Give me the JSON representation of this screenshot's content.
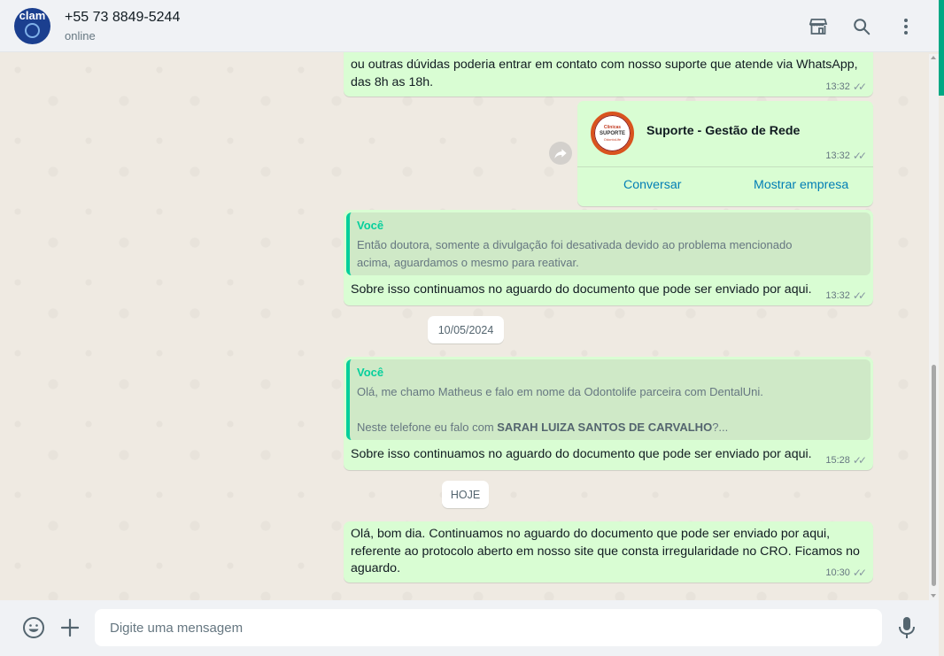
{
  "header": {
    "avatar_text": "clam",
    "contact_name": "+55 73 8849-5244",
    "status": "online",
    "icons": [
      "store-icon",
      "search-icon",
      "menu-icon"
    ]
  },
  "messages": {
    "m1": {
      "text_line1": "ou outras dúvidas poderia entrar em contato com nosso suporte que atende via WhatsApp,",
      "text_line2": "das 8h as 18h.",
      "time": "13:32"
    },
    "card": {
      "logo_line1": "Clinicas",
      "logo_line2": "SUPORTE",
      "logo_line3": "OdontoLife",
      "title": "Suporte - Gestão de Rede",
      "time": "13:32",
      "action1": "Conversar",
      "action2": "Mostrar empresa"
    },
    "m3": {
      "quote_author": "Você",
      "quote_line1": "Então doutora, somente a divulgação foi desativada devido ao problema mencionado",
      "quote_line2": "acima, aguardamos o mesmo para reativar.",
      "text": "Sobre isso continuamos no aguardo do documento que pode ser enviado por aqui.",
      "time": "13:32"
    },
    "date1": "10/05/2024",
    "m4": {
      "quote_author": "Você",
      "quote_line1": "Olá, me chamo Matheus e falo em nome da Odontolife parceira com DentalUni.",
      "quote_line2_prefix": "Neste telefone eu falo com ",
      "quote_line2_bold": "SARAH LUIZA SANTOS DE CARVALHO",
      "quote_line2_suffix": "?...",
      "text": "Sobre isso continuamos no aguardo do documento que pode ser enviado por aqui.",
      "time": "15:28"
    },
    "date2": "HOJE",
    "m5": {
      "text_line1": "Olá, bom dia. Continuamos no aguardo do documento que pode ser enviado por aqui,",
      "text_line2": "referente ao protocolo aberto em nosso site que consta irregularidade no CRO. Ficamos no",
      "text_line3": "aguardo.",
      "time": "10:30"
    }
  },
  "footer": {
    "placeholder": "Digite uma mensagem",
    "icons": [
      "emoji-icon",
      "plus-icon",
      "microphone-icon"
    ]
  },
  "colors": {
    "outgoing_bubble": "#d9fdd3",
    "accent": "#00a884",
    "chat_background": "#efeae2",
    "link": "#027eb5"
  }
}
